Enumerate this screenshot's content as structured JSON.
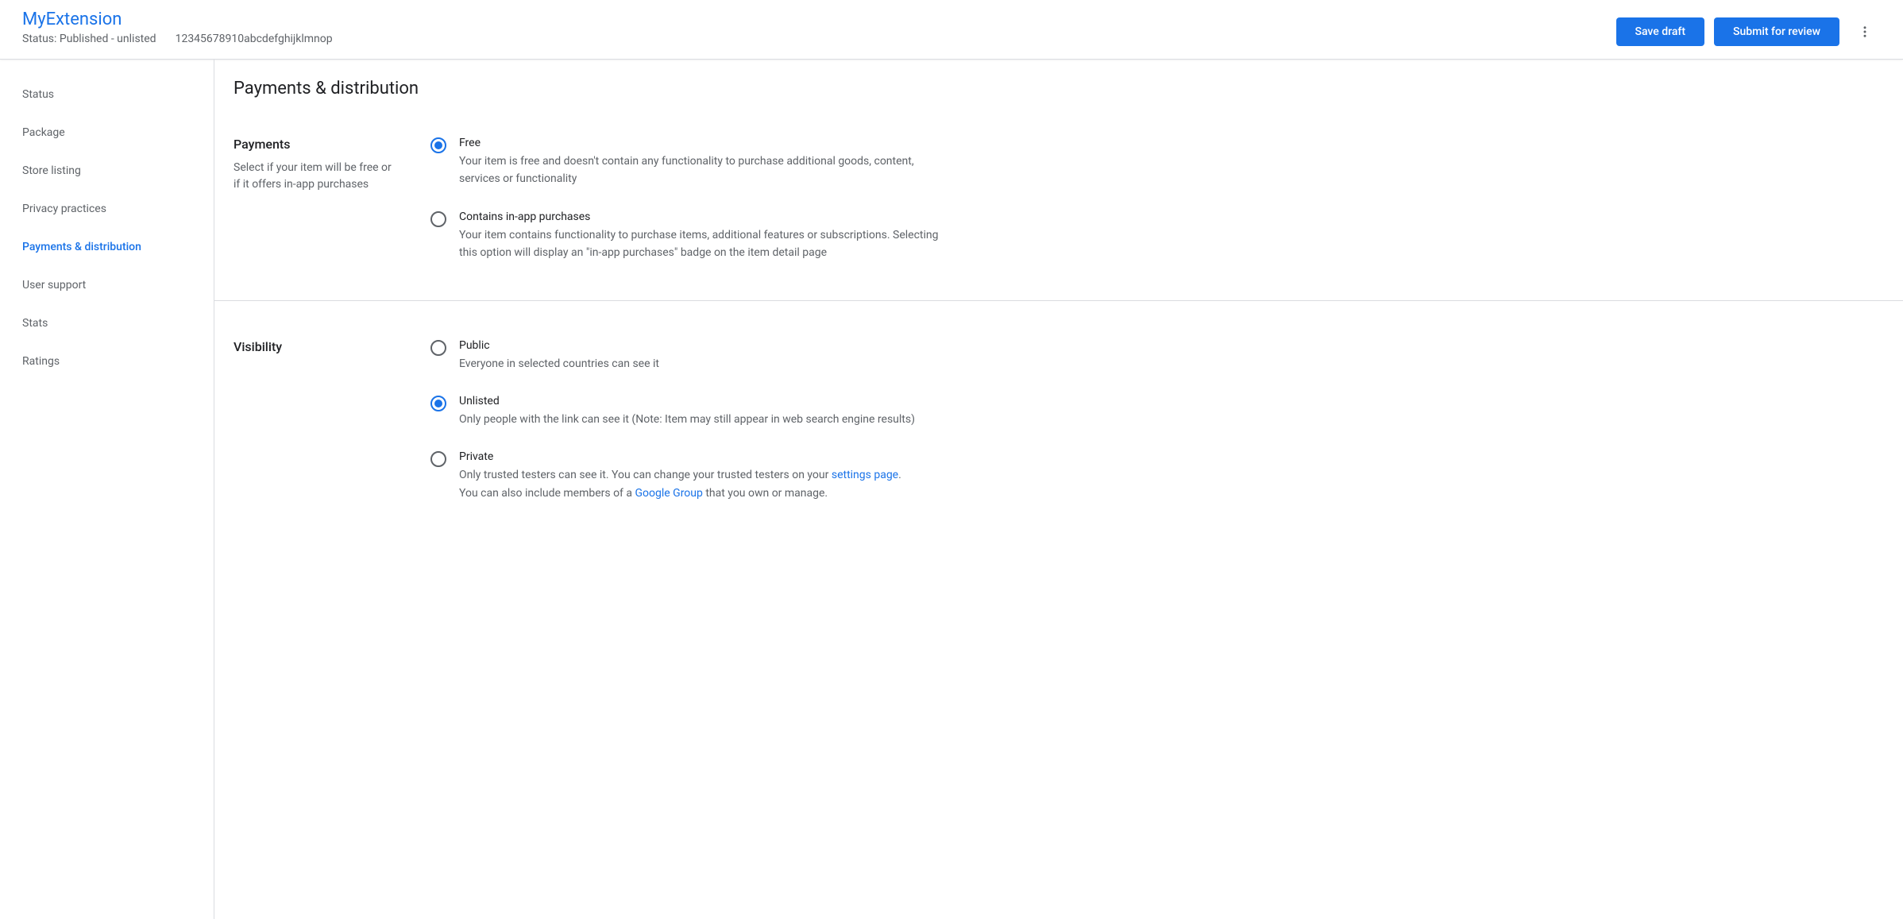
{
  "header": {
    "title": "MyExtension",
    "status_label": "Status: Published - unlisted",
    "item_id": "12345678910abcdefghijklmnop",
    "save_draft": "Save draft",
    "submit_review": "Submit for review"
  },
  "sidebar": {
    "items": [
      {
        "label": "Status"
      },
      {
        "label": "Package"
      },
      {
        "label": "Store listing"
      },
      {
        "label": "Privacy practices"
      },
      {
        "label": "Payments & distribution"
      },
      {
        "label": "User support"
      },
      {
        "label": "Stats"
      },
      {
        "label": "Ratings"
      }
    ],
    "active_index": 4
  },
  "page": {
    "title": "Payments & distribution"
  },
  "payments": {
    "heading": "Payments",
    "subheading": "Select if your item will be free or if it offers in-app purchases",
    "selected": "free",
    "options": {
      "free": {
        "title": "Free",
        "desc": "Your item is free and doesn't contain any functionality to purchase additional goods, content, services or functionality"
      },
      "iap": {
        "title": "Contains in-app purchases",
        "desc": "Your item contains functionality to purchase items, additional features or subscriptions. Selecting this option will display an \"in-app purchases\" badge on the item detail page"
      }
    }
  },
  "visibility": {
    "heading": "Visibility",
    "selected": "unlisted",
    "options": {
      "public": {
        "title": "Public",
        "desc": "Everyone in selected countries can see it"
      },
      "unlisted": {
        "title": "Unlisted",
        "desc": "Only people with the link can see it (Note: Item may still appear in web search engine results)"
      },
      "private": {
        "title": "Private",
        "desc_prefix": "Only trusted testers can see it. You can change your trusted testers on your ",
        "settings_link": "settings page",
        "desc_mid": ".",
        "desc_second": "You can also include members of a ",
        "group_link": "Google Group",
        "desc_suffix": " that you own or manage."
      }
    }
  }
}
